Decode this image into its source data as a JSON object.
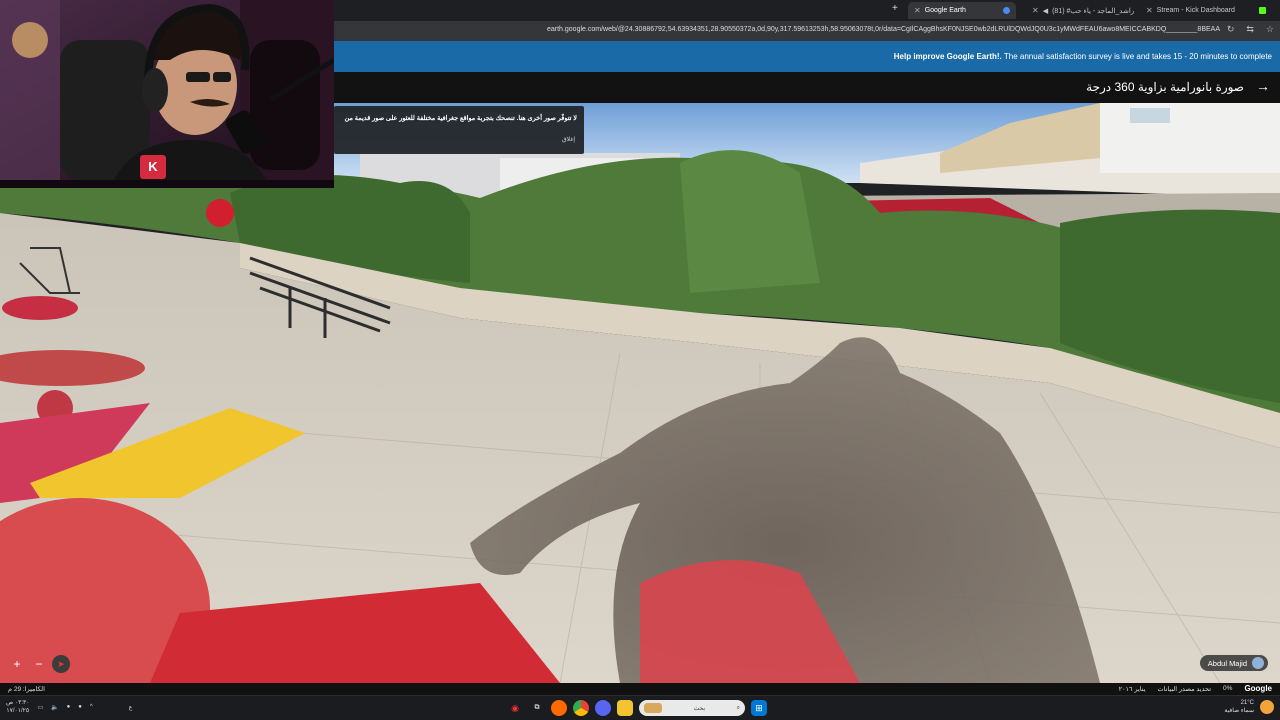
{
  "browser": {
    "tabs": [
      {
        "label": "Google Earth",
        "active": true
      },
      {
        "label": "(81) #راشد_الماجد - ياء حب",
        "active": false
      },
      {
        "label": "Stream - Kick Dashboard",
        "active": false
      }
    ],
    "new_tab_label": "+",
    "url": "earth.google.com/web/@24.30886792,54.63934351,28.90550372a,0d,90y,317.59613253h,58.95063078t,0r/data=CgIlCAggBhsKF0NJSE0wb2dLRUlDQWdJQ0U3c1yMWdFEAU6awo8MEICCABKDQ________8BEAA"
  },
  "banner": {
    "bold": "Help improve Google Earth!.",
    "text": " The annual satisfaction survey is live and takes 15 - 20 minutes to complete"
  },
  "earth_header": {
    "title": "صورة بانورامية بزاوية 360 درجة",
    "back_icon": "arrow-right-icon"
  },
  "notice": {
    "text": "لا تتوفّر صور أخرى هنا. تنصحك بتجربة مواقع جغرافية مختلفة للعثور على صور قديمة من",
    "close": "إغلاق"
  },
  "controls": {
    "zoom_in": "+",
    "zoom_out": "−"
  },
  "author": {
    "name": "Abdul Majid"
  },
  "statusbar": {
    "left": "الكاميرا: 29 م",
    "date": "يناير ٢٠١٦",
    "update": "تحديد مصدر البيانات",
    "percent": "0%",
    "brand": "Google"
  },
  "taskbar": {
    "search_placeholder": "بحث",
    "weather_temp": "21°C",
    "weather_desc": "سماء صافية",
    "clock_time": "٠٣:٣٠ ص",
    "clock_date": "١٧/٠١/٢٥",
    "lang": "ع"
  }
}
